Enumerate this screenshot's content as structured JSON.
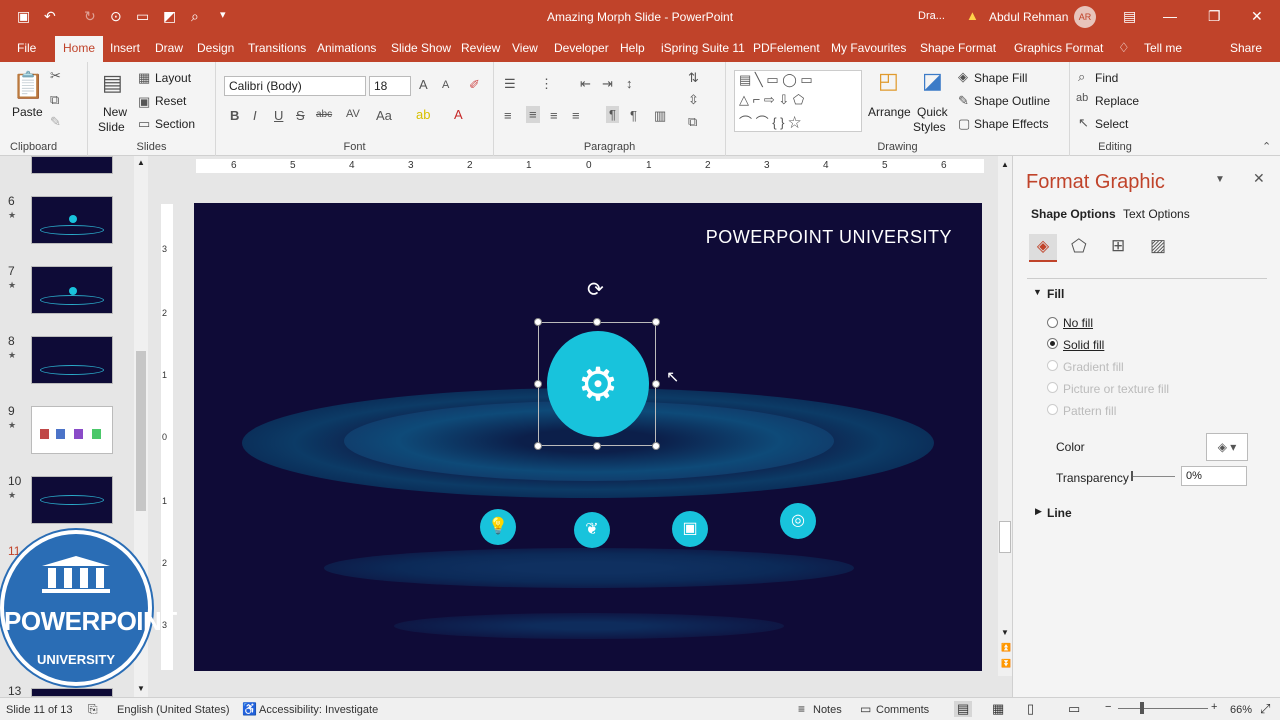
{
  "window": {
    "title": "Amazing Morph Slide  -  PowerPoint",
    "draft_label": "Dra...",
    "user_name": "Abdul Rehman",
    "user_initials": "AR"
  },
  "tabs": [
    "File",
    "Home",
    "Insert",
    "Draw",
    "Design",
    "Transitions",
    "Animations",
    "Slide Show",
    "Review",
    "View",
    "Developer",
    "Help",
    "iSpring Suite 11",
    "PDFelement",
    "My Favourites",
    "Shape Format",
    "Graphics Format",
    "Tell me",
    "Share"
  ],
  "ribbon": {
    "clipboard": {
      "paste": "Paste",
      "group": "Clipboard"
    },
    "slides": {
      "new_slide_1": "New",
      "new_slide_2": "Slide",
      "layout": "Layout",
      "reset": "Reset",
      "section": "Section",
      "group": "Slides"
    },
    "font": {
      "family": "Calibri (Body)",
      "size": "18",
      "group": "Font"
    },
    "paragraph": {
      "group": "Paragraph"
    },
    "drawing": {
      "arrange": "Arrange",
      "quick_styles_1": "Quick",
      "quick_styles_2": "Styles",
      "shape_fill": "Shape Fill",
      "shape_outline": "Shape Outline",
      "shape_effects": "Shape Effects",
      "group": "Drawing"
    },
    "editing": {
      "find": "Find",
      "replace": "Replace",
      "select": "Select",
      "group": "Editing"
    }
  },
  "thumbnails": {
    "numbers": [
      "6",
      "7",
      "8",
      "9",
      "10",
      "11",
      "13"
    ]
  },
  "slide": {
    "heading": "POWERPOINT UNIVERSITY"
  },
  "ruler": {
    "h_ticks": [
      "6",
      "5",
      "4",
      "3",
      "2",
      "1",
      "0",
      "1",
      "2",
      "3",
      "4",
      "5",
      "6"
    ],
    "v_ticks": [
      "3",
      "2",
      "1",
      "0",
      "1",
      "2",
      "3"
    ]
  },
  "format_pane": {
    "title": "Format Graphic",
    "tab_shape": "Shape Options",
    "tab_text": "Text Options",
    "fill_section": "Fill",
    "no_fill": "No fill",
    "solid_fill": "Solid fill",
    "gradient_fill": "Gradient fill",
    "picture_fill": "Picture or texture fill",
    "pattern_fill": "Pattern fill",
    "color_label": "Color",
    "transparency_label": "Transparency",
    "transparency_value": "0%",
    "line_section": "Line"
  },
  "status": {
    "slide_info": "Slide 11 of 13",
    "language": "English (United States)",
    "accessibility": "Accessibility: Investigate",
    "notes": "Notes",
    "comments": "Comments",
    "zoom": "66%"
  },
  "watermark": {
    "line1": "POWERPOINT",
    "line2": "UNIVERSITY"
  }
}
